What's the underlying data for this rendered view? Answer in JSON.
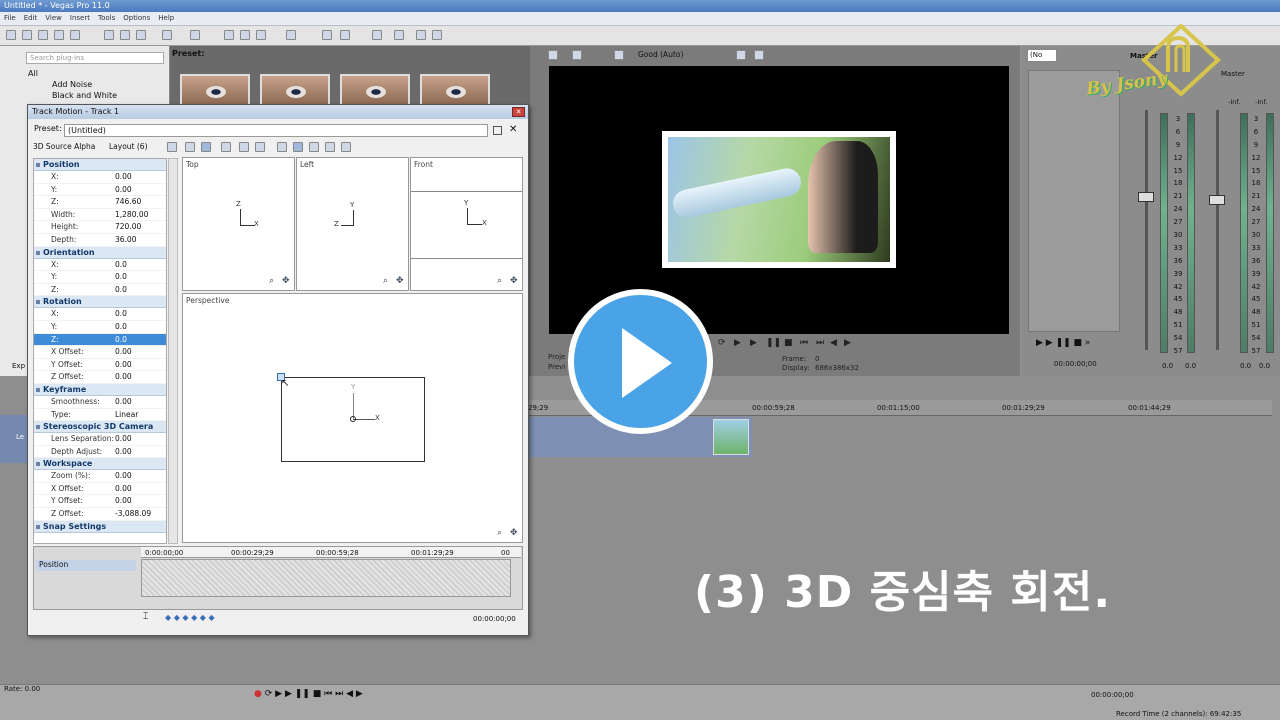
{
  "app": {
    "title": "Untitled * - Vegas Pro 11.0",
    "menu": [
      "File",
      "Edit",
      "View",
      "Insert",
      "Tools",
      "Options",
      "Help"
    ]
  },
  "explorer": {
    "search_placeholder": "Search plug-ins",
    "preset_label": "Preset:",
    "tree": [
      "All",
      "Add Noise",
      "Black and White"
    ],
    "tab_label": "Exp"
  },
  "preview": {
    "quality": "Good (Auto)",
    "frame_label": "Frame:",
    "frame_value": "0",
    "display_label": "Display:",
    "display_value": "686x386x32",
    "project_label": "Proje",
    "preview_label": "Previ"
  },
  "trim": {
    "select_value": "(No",
    "timecode": "00:00:00;00"
  },
  "master": {
    "title": "Master",
    "scale": [
      "3",
      "6",
      "9",
      "12",
      "15",
      "18",
      "21",
      "24",
      "27",
      "30",
      "33",
      "36",
      "39",
      "42",
      "45",
      "48",
      "51",
      "54",
      "57"
    ],
    "left_value": "0.0",
    "right_value": "0.0",
    "inf_label": "-Inf."
  },
  "timeline": {
    "ruler_ticks": [
      "29;29",
      "00:00:59;28",
      "00:01:15;00",
      "00:01:29;29",
      "00:01:44;29"
    ],
    "track_label": "Le",
    "rate_label": "Rate: 0.00",
    "bottom_time": "00:00:00;00",
    "record_time": "Record Time (2 channels): 69:42:35"
  },
  "dialog": {
    "title": "Track Motion - Track 1",
    "preset_label": "Preset:",
    "preset_value": "(Untitled)",
    "source_alpha": "3D Source Alpha",
    "layout": "Layout (6)",
    "groups": [
      {
        "name": "Position",
        "rows": [
          [
            "X:",
            "0.00"
          ],
          [
            "Y:",
            "0.00"
          ],
          [
            "Z:",
            "746.60"
          ],
          [
            "Width:",
            "1,280.00"
          ],
          [
            "Height:",
            "720.00"
          ],
          [
            "Depth:",
            "36.00"
          ]
        ]
      },
      {
        "name": "Orientation",
        "rows": [
          [
            "X:",
            "0.0"
          ],
          [
            "Y:",
            "0.0"
          ],
          [
            "Z:",
            "0.0"
          ]
        ]
      },
      {
        "name": "Rotation",
        "rows": [
          [
            "X:",
            "0.0"
          ],
          [
            "Y:",
            "0.0"
          ],
          [
            "Z:",
            "0.0"
          ],
          [
            "X Offset:",
            "0.00"
          ],
          [
            "Y Offset:",
            "0.00"
          ],
          [
            "Z Offset:",
            "0.00"
          ]
        ]
      },
      {
        "name": "Keyframe",
        "rows": [
          [
            "Smoothness:",
            "0.00"
          ],
          [
            "Type:",
            "Linear"
          ]
        ]
      },
      {
        "name": "Stereoscopic 3D Camera",
        "rows": [
          [
            "Lens Separation:",
            "0.00"
          ],
          [
            "Depth Adjust:",
            "0.00"
          ]
        ]
      },
      {
        "name": "Workspace",
        "rows": [
          [
            "Zoom (%):",
            "0.00"
          ],
          [
            "X Offset:",
            "0.00"
          ],
          [
            "Y Offset:",
            "0.00"
          ],
          [
            "Z Offset:",
            "-3,088.09"
          ]
        ]
      },
      {
        "name": "Snap Settings",
        "rows": []
      }
    ],
    "views": {
      "top": "Top",
      "left": "Left",
      "front": "Front",
      "perspective": "Perspective"
    },
    "axes": {
      "x": "X",
      "y": "Y",
      "z": "Z"
    },
    "keyframe": {
      "track_label": "Position",
      "ruler": [
        "0:00:00;00",
        "00:00:29;29",
        "00:00:59;28",
        "00:01:29;29",
        "00"
      ],
      "cursor_time": "00:00:00;00"
    }
  },
  "caption": "(3) 3D 중심축 회전.",
  "logo_text": "By Jsony",
  "colors": {
    "accent": "#4aa3e6",
    "selection": "#3e8bd8",
    "video_event": "#7d8fb3"
  }
}
